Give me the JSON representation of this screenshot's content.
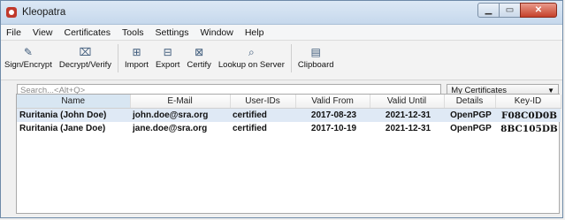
{
  "window": {
    "title": "Kleopatra",
    "min": "▁",
    "max": "▭",
    "close": "✕"
  },
  "menu": [
    "File",
    "View",
    "Certificates",
    "Tools",
    "Settings",
    "Window",
    "Help"
  ],
  "toolbar": [
    {
      "label": "Sign/Encrypt",
      "icon": "sign-encrypt-icon"
    },
    {
      "label": "Decrypt/Verify",
      "icon": "decrypt-verify-icon"
    },
    {
      "label": "Import",
      "icon": "import-icon"
    },
    {
      "label": "Export",
      "icon": "export-icon"
    },
    {
      "label": "Certify",
      "icon": "certify-icon"
    },
    {
      "label": "Lookup on Server",
      "icon": "search-icon"
    },
    {
      "label": "Clipboard",
      "icon": "clipboard-icon"
    }
  ],
  "search": {
    "placeholder": "Search...<Alt+Q>"
  },
  "filter": {
    "selected": "My Certificates"
  },
  "table": {
    "columns": [
      "Name",
      "E-Mail",
      "User-IDs",
      "Valid From",
      "Valid Until",
      "Details",
      "Key-ID"
    ],
    "rows": [
      [
        "Ruritania (John Doe)",
        "john.doe@sra.org",
        "certified",
        "2017-08-23",
        "2021-12-31",
        "OpenPGP",
        "F08C0D0B"
      ],
      [
        "Ruritania (Jane Doe)",
        "jane.doe@sra.org",
        "certified",
        "2017-10-19",
        "2021-12-31",
        "OpenPGP",
        "8BC105DB"
      ]
    ]
  },
  "colors": {
    "selection": "#dfe9f5",
    "title_bar": "#c6d8ec"
  }
}
